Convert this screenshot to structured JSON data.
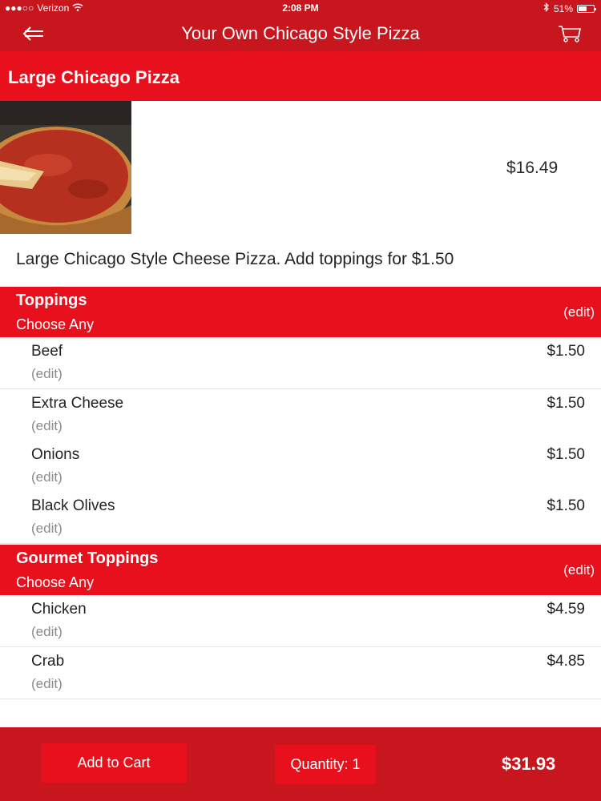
{
  "status_bar": {
    "carrier": "Verizon",
    "time": "2:08 PM",
    "battery": "51%"
  },
  "nav": {
    "title": "Your Own Chicago Style Pizza"
  },
  "item": {
    "name": "Large Chicago Pizza",
    "price": "$16.49",
    "description": "Large Chicago Style Cheese Pizza. Add toppings for $1.50"
  },
  "sections": [
    {
      "name": "Toppings",
      "subtitle": "Choose Any",
      "edit": "(edit)",
      "options": [
        {
          "name": "Beef",
          "price": "$1.50",
          "edit": "(edit)"
        },
        {
          "name": "Extra Cheese",
          "price": "$1.50",
          "edit": "(edit)"
        },
        {
          "name": "Onions",
          "price": "$1.50",
          "edit": "(edit)"
        },
        {
          "name": "Black Olives",
          "price": "$1.50",
          "edit": "(edit)"
        }
      ]
    },
    {
      "name": "Gourmet Toppings",
      "subtitle": "Choose Any",
      "edit": "(edit)",
      "options": [
        {
          "name": "Chicken",
          "price": "$4.59",
          "edit": "(edit)"
        },
        {
          "name": "Crab",
          "price": "$4.85",
          "edit": "(edit)"
        }
      ]
    }
  ],
  "footer": {
    "add_to_cart": "Add to Cart",
    "quantity": "Quantity: 1",
    "total": "$31.93"
  },
  "colors": {
    "primary_red": "#e8101c",
    "dark_red": "#c8161f"
  }
}
